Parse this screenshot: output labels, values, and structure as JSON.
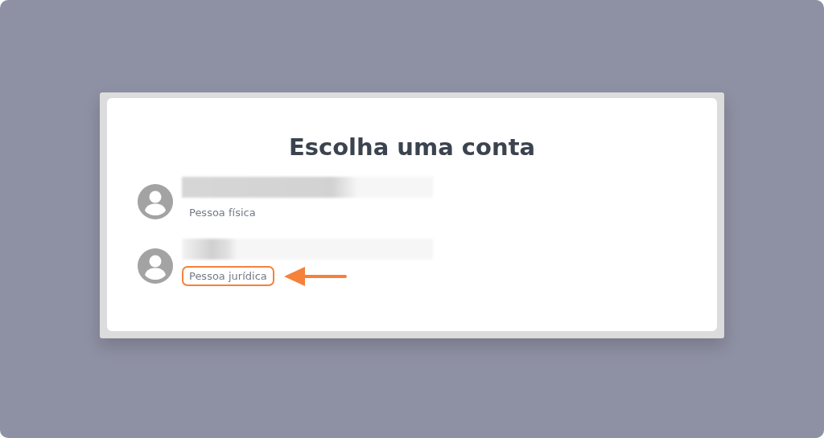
{
  "dialog": {
    "title": "Escolha uma conta"
  },
  "accounts": [
    {
      "type": "Pessoa física",
      "highlighted": false
    },
    {
      "type": "Pessoa jurídica",
      "highlighted": true
    }
  ]
}
